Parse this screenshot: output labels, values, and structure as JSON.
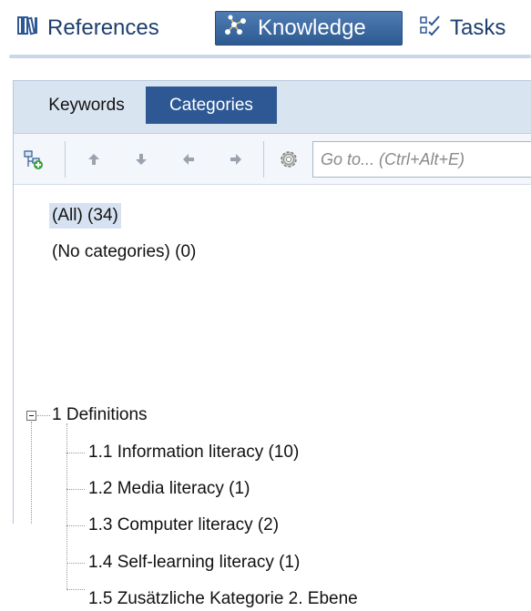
{
  "nav": {
    "references": {
      "label": "References",
      "icon": "library-icon"
    },
    "knowledge": {
      "label": "Knowledge",
      "icon": "network-icon"
    },
    "tasks": {
      "label": "Tasks",
      "icon": "checklist-icon"
    }
  },
  "panel": {
    "tabs": [
      {
        "label": "Keywords",
        "selected": false
      },
      {
        "label": "Categories",
        "selected": true
      }
    ],
    "toolbar": {
      "goto_placeholder": "Go to... (Ctrl+Alt+E)"
    },
    "tree": {
      "all": "(All) (34)",
      "no_categories": "(No categories) (0)",
      "root": {
        "label": "1 Definitions",
        "expanded": true,
        "children": [
          "1.1 Information literacy (10)",
          "1.2 Media literacy (1)",
          "1.3 Computer literacy (2)",
          "1.4 Self-learning literacy (1)",
          "1.5 Zusätzliche Kategorie 2. Ebene"
        ]
      }
    }
  },
  "colors": {
    "accent": "#2d5894",
    "tab_bar": "#d9e4f1",
    "selection": "#d6e2f1"
  }
}
